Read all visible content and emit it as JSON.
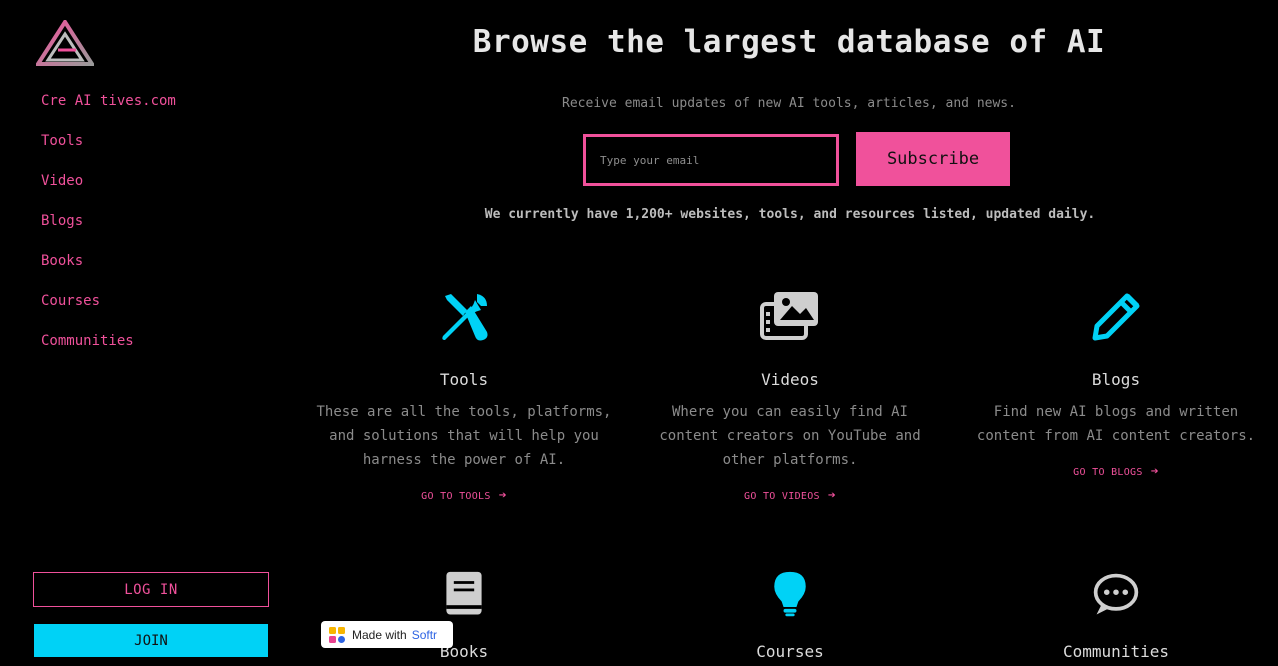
{
  "sidebar": {
    "logo_name": "site-logo",
    "nav": [
      {
        "label": "Cre AI tives.com"
      },
      {
        "label": "Tools"
      },
      {
        "label": "Video"
      },
      {
        "label": "Blogs"
      },
      {
        "label": "Books"
      },
      {
        "label": "Courses"
      },
      {
        "label": "Communities"
      }
    ],
    "login_label": "LOG IN",
    "join_label": "JOIN"
  },
  "hero": {
    "title": "Browse the largest database of AI",
    "subtitle": "Receive email updates of new AI tools, articles, and news.",
    "email_placeholder": "Type your email",
    "subscribe_label": "Subscribe",
    "stats": "We currently have 1,200+ websites, tools, and resources listed, updated daily."
  },
  "cards": [
    {
      "title": "Tools",
      "desc": "These are all the tools, platforms, and solutions that will help you harness the power of AI.",
      "link": "GO TO TOOLS",
      "icon": "tools-icon"
    },
    {
      "title": "Videos",
      "desc": "Where you can easily find AI content creators on YouTube and other platforms.",
      "link": "GO TO VIDEOS",
      "icon": "images-icon"
    },
    {
      "title": "Blogs",
      "desc": "Find new AI blogs and written content from AI content creators.",
      "link": "GO TO BLOGS",
      "icon": "pencil-icon"
    },
    {
      "title": "Books",
      "icon": "book-icon"
    },
    {
      "title": "Courses",
      "icon": "lightbulb-icon"
    },
    {
      "title": "Communities",
      "icon": "chat-icon"
    }
  ],
  "badge": {
    "made_with": "Made with",
    "brand": "Softr"
  },
  "colors": {
    "accent": "#f0519b",
    "cyan": "#00d2f6",
    "background": "#000000",
    "icon_gray": "#cfcfcf"
  }
}
